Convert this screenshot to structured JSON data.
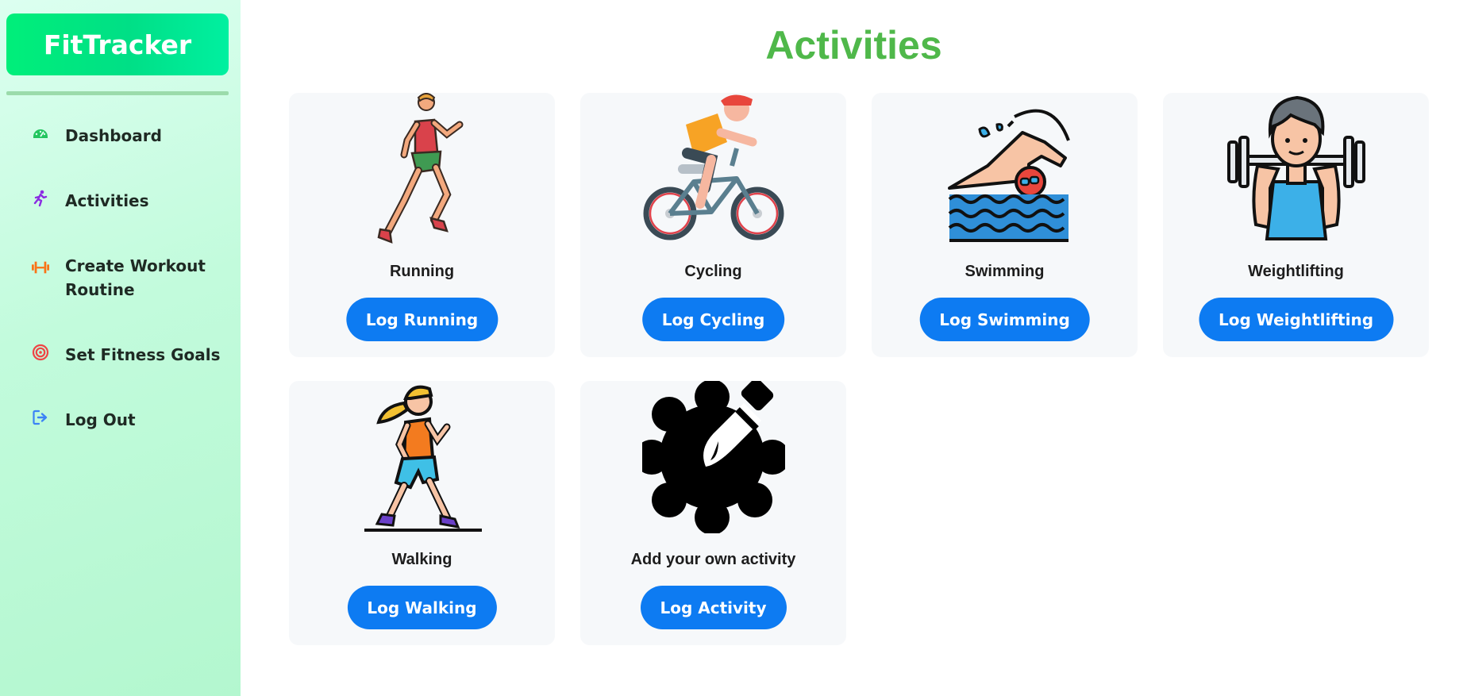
{
  "sidebar": {
    "logo": "FitTracker",
    "items": [
      {
        "label": "Dashboard",
        "icon": "gauge-icon",
        "color": "#22c55e"
      },
      {
        "label": "Activities",
        "icon": "running-person-icon",
        "color": "#8b2be2"
      },
      {
        "label": "Create Workout Routine",
        "icon": "dumbbell-icon",
        "color": "#f97316"
      },
      {
        "label": "Set Fitness Goals",
        "icon": "target-icon",
        "color": "#ef4444"
      },
      {
        "label": "Log Out",
        "icon": "logout-icon",
        "color": "#3b82f6"
      }
    ]
  },
  "main": {
    "title": "Activities",
    "activities": [
      {
        "name": "Running",
        "button": "Log Running",
        "icon": "runner-icon"
      },
      {
        "name": "Cycling",
        "button": "Log Cycling",
        "icon": "cyclist-icon"
      },
      {
        "name": "Swimming",
        "button": "Log Swimming",
        "icon": "swimmer-icon"
      },
      {
        "name": "Weightlifting",
        "button": "Log Weightlifting",
        "icon": "weightlifter-icon"
      },
      {
        "name": "Walking",
        "button": "Log Walking",
        "icon": "walker-icon"
      },
      {
        "name": "Add your own activity",
        "button": "Log Activity",
        "icon": "gear-pencil-icon"
      }
    ]
  },
  "colors": {
    "accent": "#0d7bf2",
    "title": "#4fb84a",
    "logo": "#00e07f"
  }
}
